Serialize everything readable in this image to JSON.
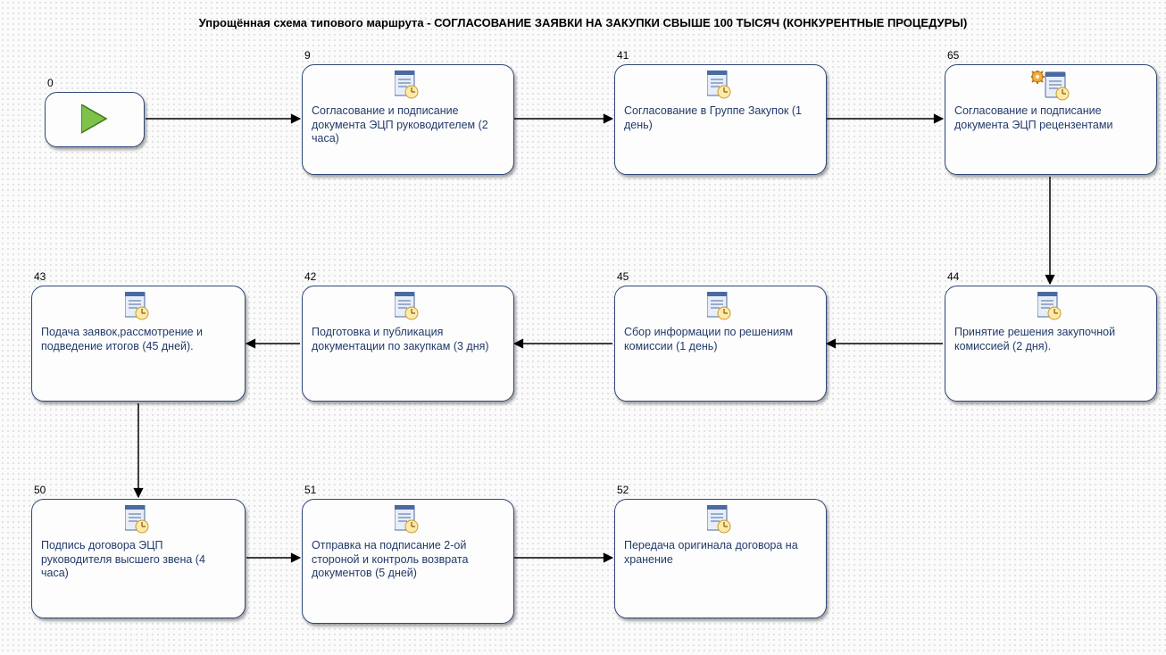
{
  "title": "Упрощённая схема типового маршрута - СОГЛАСОВАНИЕ ЗАЯВКИ НА ЗАКУПКИ СВЫШЕ 100 ТЫСЯЧ (КОНКУРЕНТНЫЕ ПРОЦЕДУРЫ)",
  "start": {
    "num": "0"
  },
  "nodes": {
    "n9": {
      "num": "9",
      "label": "Согласование и подписание документа ЭЦП руководителем (2 часа)",
      "special": false
    },
    "n41": {
      "num": "41",
      "label": "Согласование в Группе Закупок (1 день)",
      "special": false
    },
    "n65": {
      "num": "65",
      "label": "Согласование и подписание документа ЭЦП рецензентами",
      "special": true
    },
    "n44": {
      "num": "44",
      "label": "Принятие решения закупочной комиссией (2 дня).",
      "special": false
    },
    "n45": {
      "num": "45",
      "label": "Сбор информации по решениям комиссии (1 день)",
      "special": false
    },
    "n42": {
      "num": "42",
      "label": "Подготовка и публикация документации по закупкам (3 дня)",
      "special": false
    },
    "n43": {
      "num": "43",
      "label": "Подача заявок,рассмотрение и подведение итогов (45 дней).",
      "special": false
    },
    "n50": {
      "num": "50",
      "label": "Подпись договора ЭЦП руководителя высшего звена (4 часа)",
      "special": false
    },
    "n51": {
      "num": "51",
      "label": "Отправка на подписание 2-ой стороной и контроль возврата документов (5 дней)",
      "special": false
    },
    "n52": {
      "num": "52",
      "label": "Передача оригинала договора на хранение",
      "special": false
    }
  },
  "chart_data": {
    "type": "flowchart",
    "title": "Упрощённая схема типового маршрута - СОГЛАСОВАНИЕ ЗАЯВКИ НА ЗАКУПКИ СВЫШЕ 100 ТЫСЯЧ (КОНКУРЕНТНЫЕ ПРОЦЕДУРЫ)",
    "nodes": [
      {
        "id": 0,
        "kind": "start"
      },
      {
        "id": 9,
        "kind": "task",
        "label": "Согласование и подписание документа ЭЦП руководителем (2 часа)"
      },
      {
        "id": 41,
        "kind": "task",
        "label": "Согласование в Группе Закупок (1 день)"
      },
      {
        "id": 65,
        "kind": "task-special",
        "label": "Согласование и подписание документа ЭЦП рецензентами"
      },
      {
        "id": 44,
        "kind": "task",
        "label": "Принятие решения закупочной комиссией (2 дня)."
      },
      {
        "id": 45,
        "kind": "task",
        "label": "Сбор информации по решениям комиссии (1 день)"
      },
      {
        "id": 42,
        "kind": "task",
        "label": "Подготовка и публикация документации по закупкам (3 дня)"
      },
      {
        "id": 43,
        "kind": "task",
        "label": "Подача заявок,рассмотрение и подведение итогов (45 дней)."
      },
      {
        "id": 50,
        "kind": "task",
        "label": "Подпись договора ЭЦП руководителя высшего звена (4 часа)"
      },
      {
        "id": 51,
        "kind": "task",
        "label": "Отправка на подписание 2-ой стороной и контроль возврата документов (5 дней)"
      },
      {
        "id": 52,
        "kind": "task",
        "label": "Передача оригинала договора на хранение"
      }
    ],
    "edges": [
      [
        0,
        9
      ],
      [
        9,
        41
      ],
      [
        41,
        65
      ],
      [
        65,
        44
      ],
      [
        44,
        45
      ],
      [
        45,
        42
      ],
      [
        42,
        43
      ],
      [
        43,
        50
      ],
      [
        50,
        51
      ],
      [
        51,
        52
      ]
    ]
  }
}
